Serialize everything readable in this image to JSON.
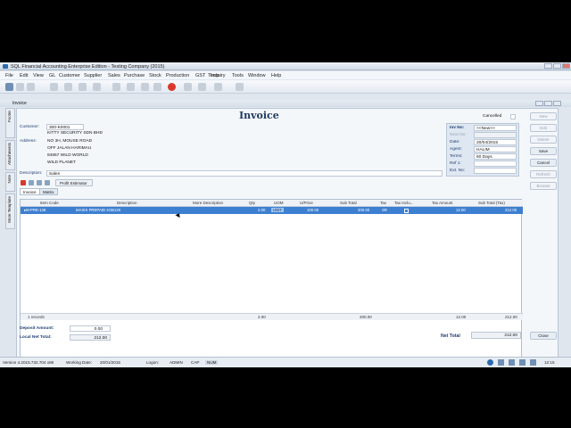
{
  "window": {
    "title": "SQL Financial Accounting Enterprise Edition - Testing Company (2015)"
  },
  "menu": [
    "File",
    "Edit",
    "View",
    "GL",
    "Customer",
    "Supplier",
    "Sales",
    "Purchase",
    "Stock",
    "Production",
    "GST",
    "Tools",
    "Inquiry",
    "Tools",
    "Window",
    "Help"
  ],
  "child_window": {
    "title": "Invoice"
  },
  "side_tabs": [
    "Footer",
    "Attachments",
    "Note",
    "More Template"
  ],
  "heading": "Invoice",
  "customer": {
    "label": "Customer:",
    "code": "300-K0001",
    "name": "KITTY SECURITY SDN BHD",
    "address_label": "Address:",
    "address_lines": [
      "NO 3H, MOUSE ROAD",
      "OFF JALAN HARIMAU",
      "84657 WILD WORLD",
      "WILD PLANET"
    ],
    "description_label": "Description:",
    "description": "Sales"
  },
  "doc": {
    "cancelled_label": "Cancelled",
    "inv_no_label": "Inv No:",
    "inv_no": "<<New>>",
    "next_no_label": "Next No:",
    "date_label": "Date:",
    "date": "20/04/2015",
    "agent_label": "Agent:",
    "agent": "HALIM",
    "terms_label": "Terms:",
    "terms": "60 Days",
    "ref1_label": "Ref 1:",
    "ext_no_label": "Ext. No:"
  },
  "side_buttons": [
    "New",
    "Edit",
    "Delete",
    "Save",
    "Cancel",
    "Refresh",
    "Browse"
  ],
  "mini_tools": {
    "profit_estimator": "Profit Estimator"
  },
  "tabs": [
    "Invoice",
    "Matrix"
  ],
  "grid": {
    "headers": [
      "Item Code",
      "Description",
      "More Description",
      "Qty",
      "UOM",
      "U/Price",
      "Sub Total",
      "Tax",
      "Tax Inclu...",
      "Tax Amount",
      "Sub Total (Tax)"
    ],
    "row": [
      "M-PRE-128",
      "MAXIS PREPAID 4GB128",
      "",
      "2.00",
      "UNIT",
      "100.00",
      "200.00",
      "SR",
      "",
      "12.00",
      "212.00"
    ],
    "footer": {
      "records": "1 records",
      "qty_total": "2.00",
      "subtotal_total": "200.00",
      "tax_total": "12.00",
      "grand_total": "212.00"
    }
  },
  "totals": {
    "deposit_label": "Deposit Amount:",
    "deposit": "0.00",
    "local_net_label": "Local Net Total:",
    "local_net": "212.00",
    "net_label": "Net Total",
    "net": "212.00"
  },
  "close_label": "Close",
  "status": {
    "version": "Version 4.2015.732.704 x86",
    "working_date_label": "Working Date:",
    "working_date": "20/01/2015",
    "logon_label": "Logon:",
    "logon": "ADMIN",
    "caps": "CAP",
    "num": "NUM",
    "clock": "12:15"
  },
  "colors": {
    "accent": "#3d7fd0",
    "heading": "#1f3b63",
    "label": "#1d3d73",
    "cancel_red": "#d9382c"
  }
}
